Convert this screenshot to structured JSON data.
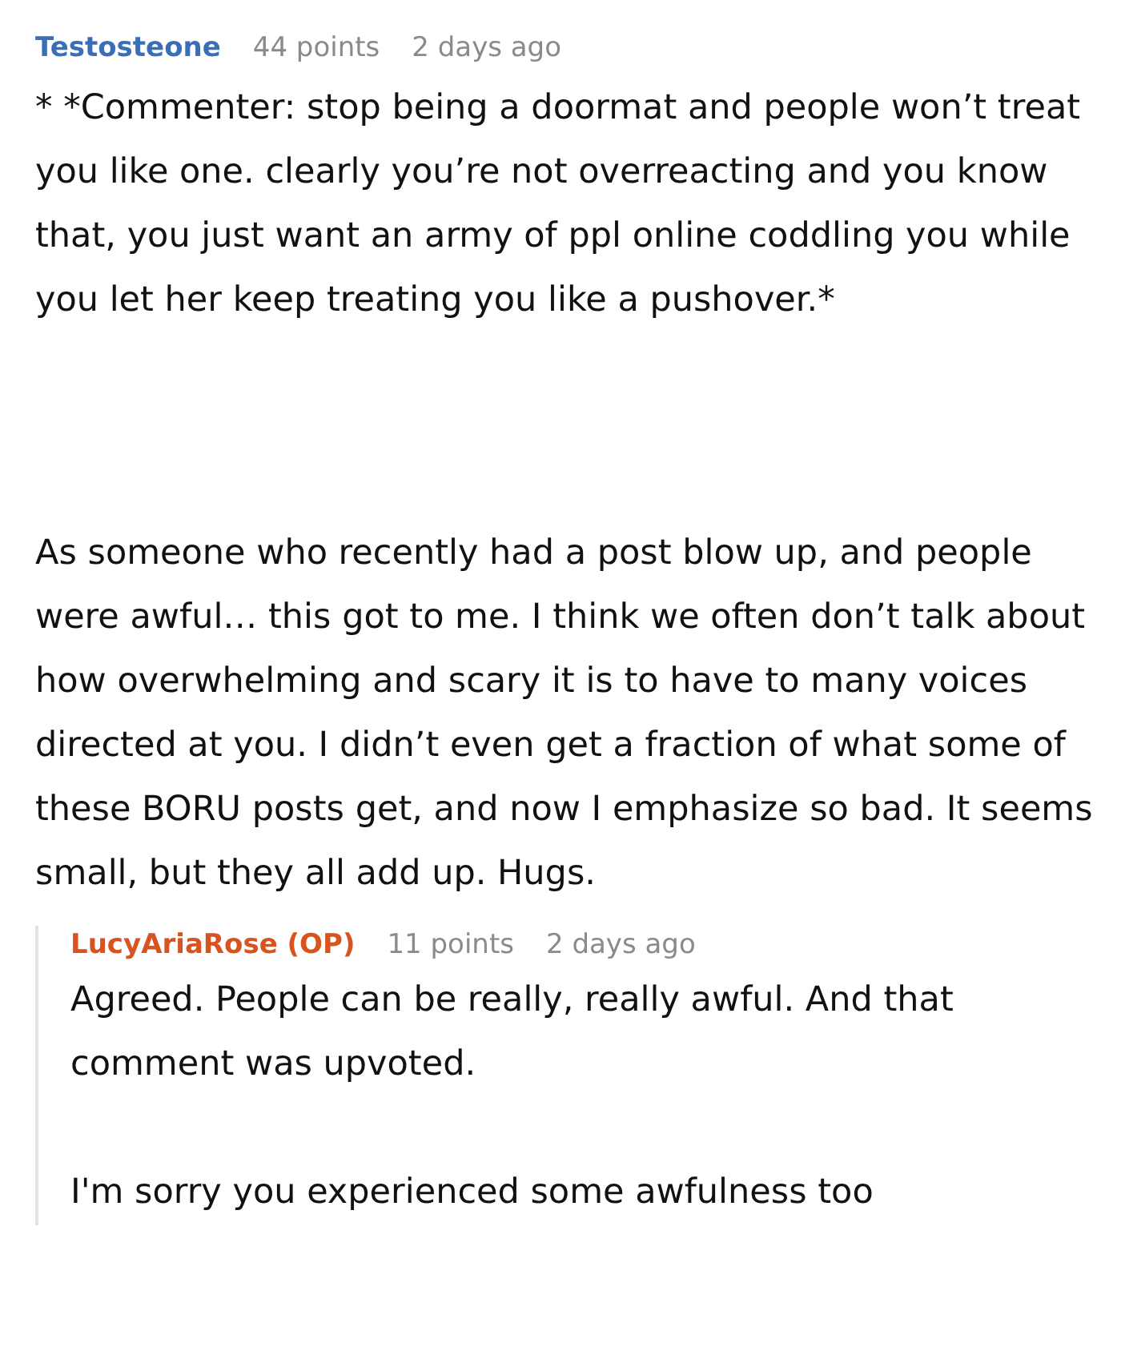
{
  "comments": [
    {
      "author": "Testosteone",
      "color": "#3a6fb8",
      "points": "44 points",
      "time": "2 days ago",
      "paragraphs": [
        "* *Commenter: stop being a doormat and people won’t treat you like one. clearly you’re not overreacting and you know that, you just want an army of ppl online coddling you while you let her keep treating you like a pushover.*",
        "As someone who recently had a post blow up, and people were awful… this got to me. I think we often don’t talk about how overwhelming and scary it is to have to many voices directed at you. I didn’t even get a fraction of what some of these BORU posts get, and now I emphasize so bad. It seems small, but they all add up. Hugs."
      ],
      "replies": [
        {
          "author": "LucyAriaRose (OP)",
          "color": "#d9531e",
          "points": "11 points",
          "time": "2 days ago",
          "paragraphs": [
            "Agreed. People can be really, really awful. And that comment was upvoted.",
            "I'm sorry you experienced some awfulness too"
          ]
        }
      ]
    }
  ]
}
